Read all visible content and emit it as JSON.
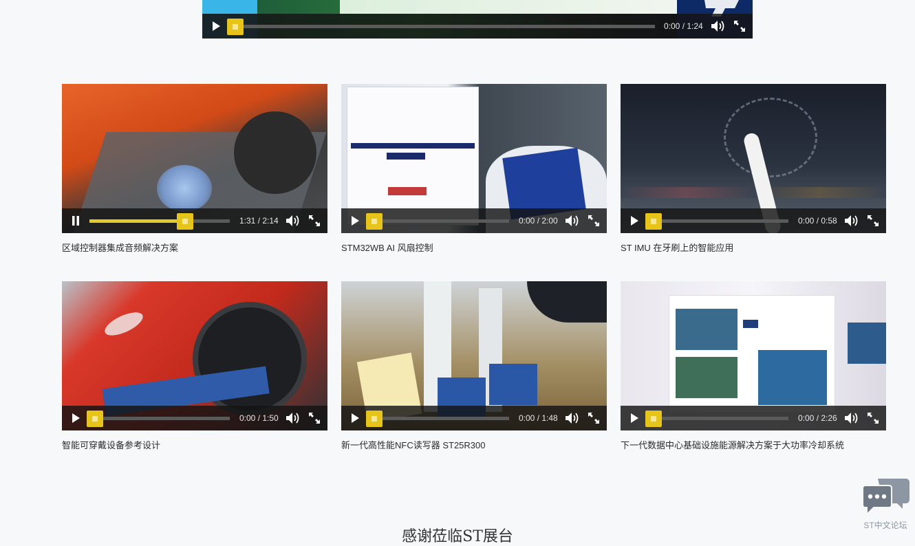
{
  "top_player": {
    "time": "0:00 / 1:24",
    "progress": 0.0
  },
  "videos": [
    {
      "title": "区域控制器集成音频解决方案",
      "time": "1:31 / 2:14",
      "progress": 0.68,
      "state": "playing"
    },
    {
      "title": "STM32WB AI 风扇控制",
      "time": "0:00 / 2:00",
      "progress": 0.0,
      "state": "paused"
    },
    {
      "title": "ST IMU 在牙刷上的智能应用",
      "time": "0:00 / 0:58",
      "progress": 0.0,
      "state": "paused"
    },
    {
      "title": "智能可穿戴设备参考设计",
      "time": "0:00 / 1:50",
      "progress": 0.0,
      "state": "paused"
    },
    {
      "title": "新一代高性能NFC读写器 ST25R300",
      "time": "0:00 / 1:48",
      "progress": 0.0,
      "state": "paused"
    },
    {
      "title": "下一代数据中心基础设施能源解决方案于大功率冷却系统",
      "time": "0:00 / 2:26",
      "progress": 0.0,
      "state": "paused"
    }
  ],
  "footer": {
    "thanks_heading": "感谢莅临ST展台"
  },
  "forum_widget": {
    "label": "ST中文论坛"
  },
  "colors": {
    "accent": "#e6c419",
    "controls_bg": "#141414",
    "page_bg": "#f7f8fa"
  },
  "icons": [
    "play-icon",
    "pause-icon",
    "volume-icon",
    "fullscreen-icon",
    "chat-bubble-icon"
  ]
}
